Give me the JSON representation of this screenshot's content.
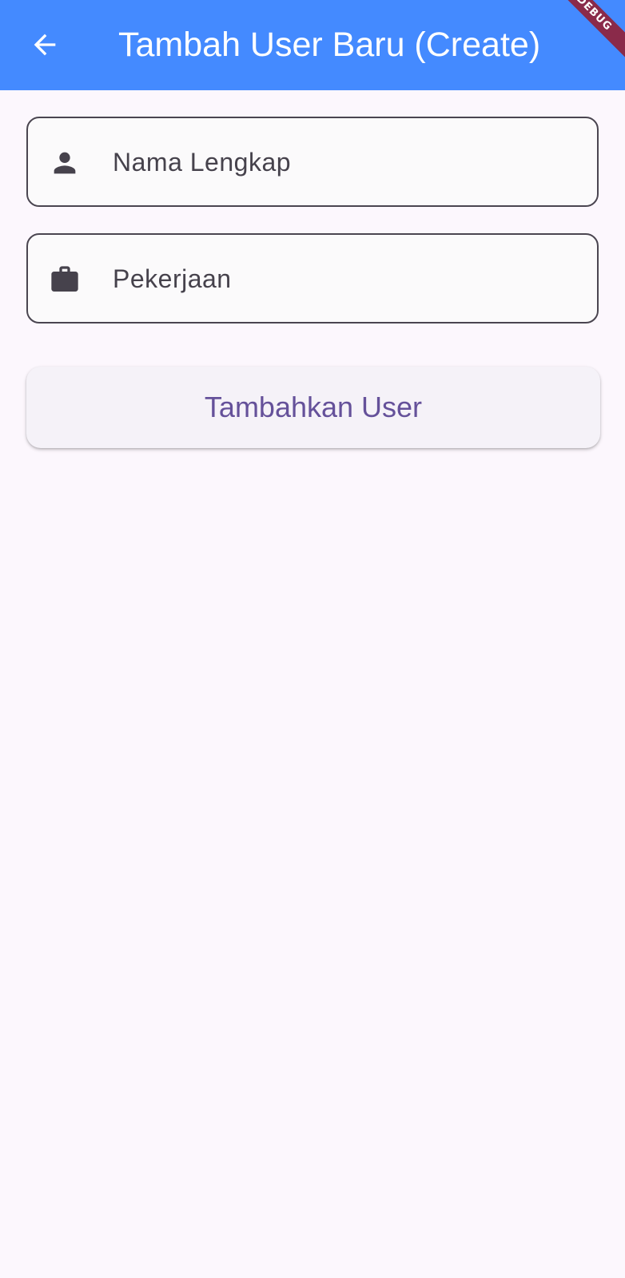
{
  "appbar": {
    "title": "Tambah User Baru (Create)",
    "back_icon": "arrow-back-icon",
    "color": "#448aff",
    "debug_banner": "DEBUG"
  },
  "form": {
    "name_field": {
      "icon": "person-icon",
      "placeholder": "Nama Lengkap",
      "value": ""
    },
    "job_field": {
      "icon": "briefcase-icon",
      "placeholder": "Pekerjaan",
      "value": ""
    },
    "submit_label": "Tambahkan User"
  },
  "colors": {
    "primary": "#448aff",
    "button_text": "#65519a",
    "background": "#fcf7fd",
    "field_border": "#4a4550"
  }
}
